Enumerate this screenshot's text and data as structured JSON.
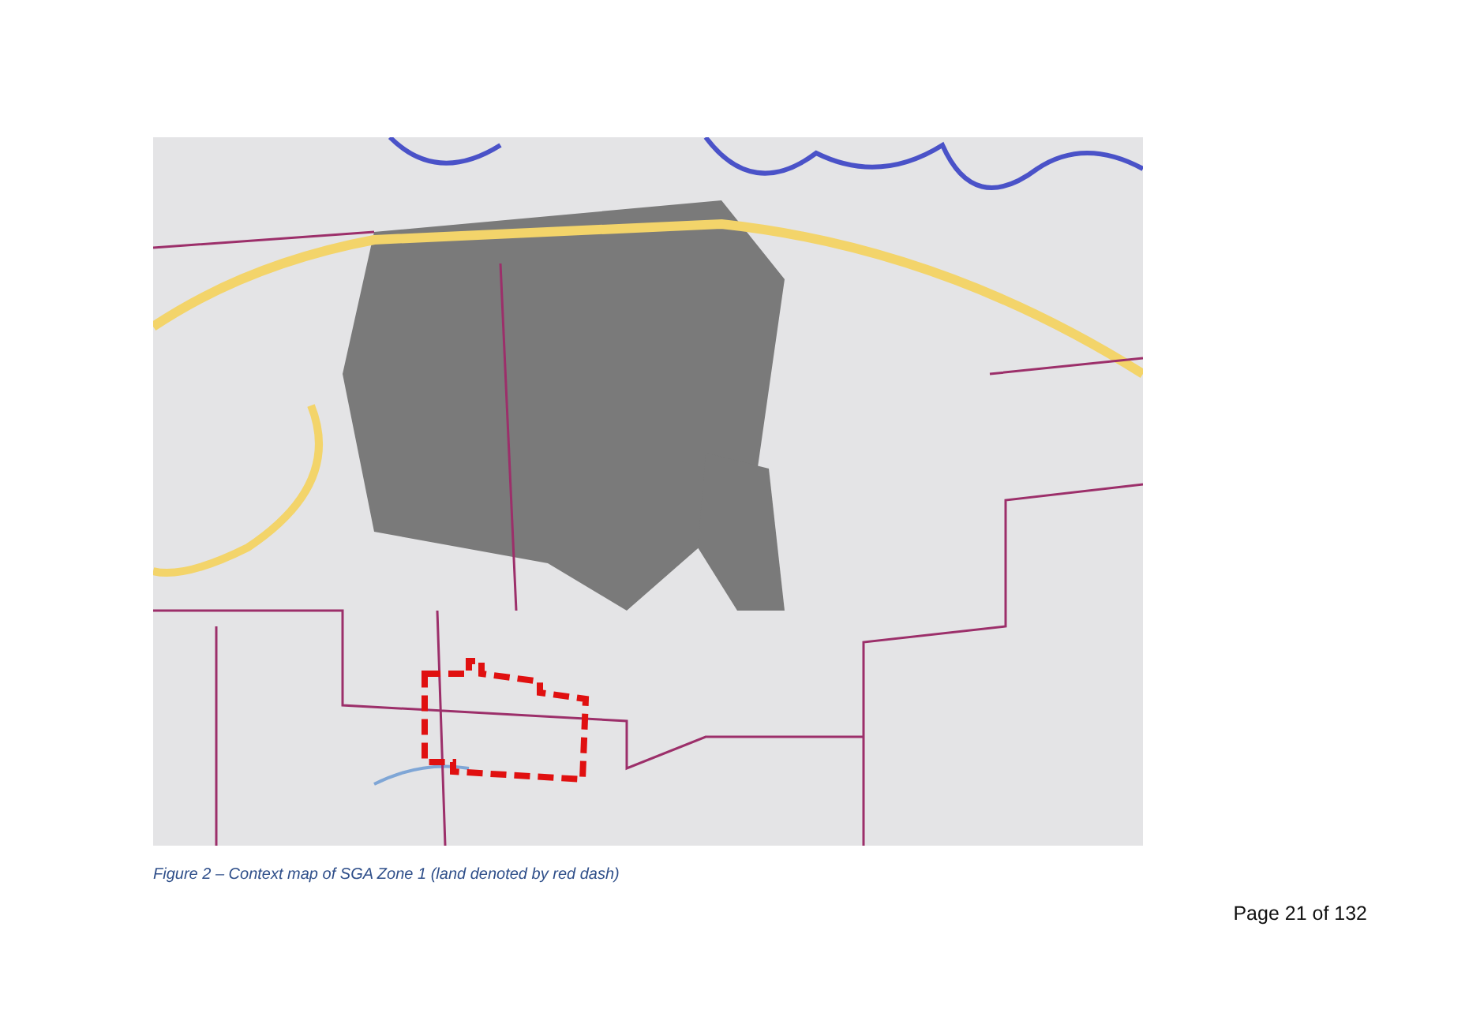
{
  "figure": {
    "caption": "Figure 2 – Context map of SGA Zone 1 (land denoted by red dash)"
  },
  "footer": {
    "page_number": "Page 21 of 132"
  }
}
